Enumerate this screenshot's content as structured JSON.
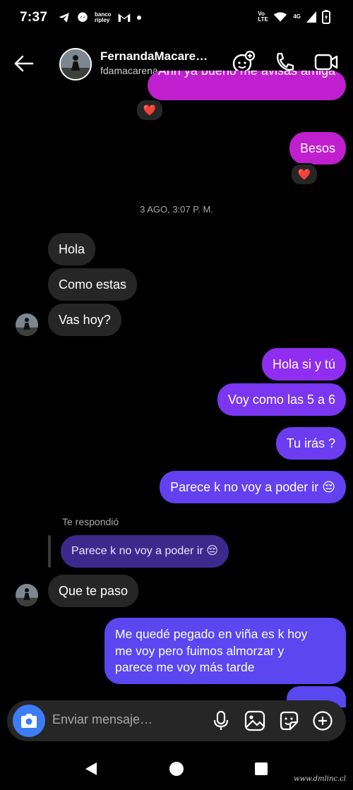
{
  "status_bar": {
    "time": "7:37",
    "icons": [
      "telegram-icon",
      "messenger-icon",
      "banco-ripley-icon",
      "gmail-icon",
      "dot-icon"
    ],
    "banco_text": "banco ripley",
    "volte": "Vo LTE",
    "network": "4G"
  },
  "header": {
    "name": "FernandaMacare…",
    "username": "fdamacarena"
  },
  "messages": {
    "m0": {
      "text": "Ahh ya bueno me avisas amiga",
      "reaction": "❤️"
    },
    "m1": {
      "text": "Besos",
      "reaction": "❤️"
    },
    "date": "3 AGO, 3:07 P. M.",
    "m2": {
      "text": "Hola"
    },
    "m3": {
      "text": "Como estas"
    },
    "m4": {
      "text": "Vas hoy?"
    },
    "m5": {
      "text": "Hola si y tú"
    },
    "m6": {
      "text": "Voy como las 5 a 6"
    },
    "m7": {
      "text": "Tu irás ?"
    },
    "m8": {
      "text": "Parece k no voy a poder ir 😔"
    },
    "reply_label": "Te respondió",
    "reply_quote": "Parece k no voy a poder ir 😔",
    "m9": {
      "text": "Que te paso"
    },
    "m10": {
      "line1": "Me quedé pegado en viña es k hoy",
      "line2": "me voy pero fuimos almorzar y",
      "line3": "parece me voy más tarde"
    }
  },
  "composer": {
    "placeholder": "Enviar mensaje…"
  },
  "watermark": "www.dmlinc.cl",
  "colors": {
    "outgoing_magenta": "#c01fcf",
    "outgoing_gradient_top": "#8f2ef0",
    "outgoing_gradient_bottom": "#5b46f0",
    "incoming": "#262626",
    "camera_button": "#3d7cf5"
  }
}
